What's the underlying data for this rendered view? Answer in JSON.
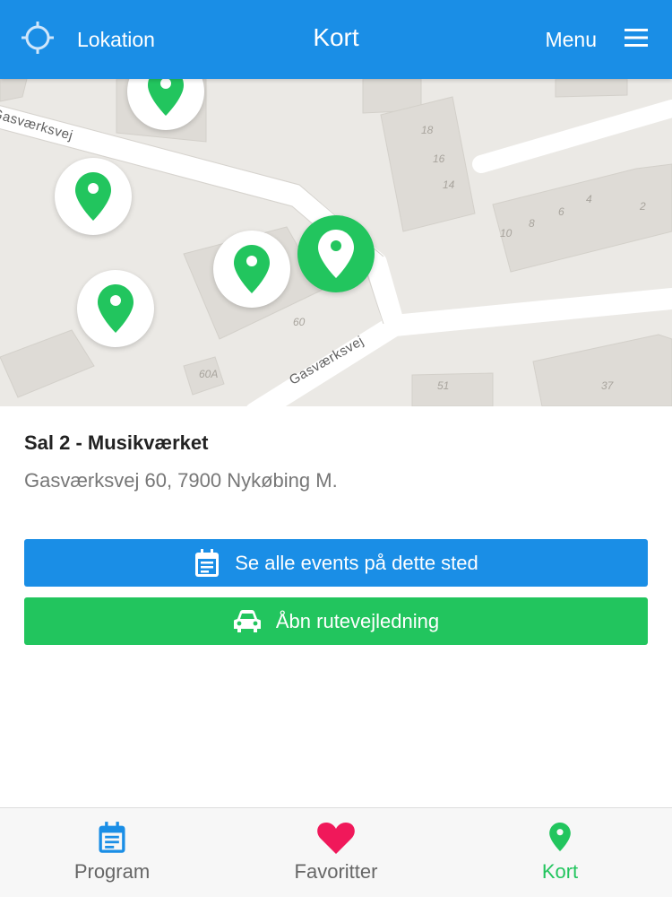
{
  "header": {
    "location_label": "Lokation",
    "title": "Kort",
    "menu_label": "Menu",
    "icons": {
      "location": "crosshair-icon",
      "menu": "hamburger-menu-icon"
    }
  },
  "map": {
    "streets": [
      "Gasværksvej",
      "Gasværksvej"
    ],
    "house_numbers": [
      "18",
      "16",
      "14",
      "10",
      "8",
      "6",
      "4",
      "2",
      "60",
      "60A",
      "51",
      "37"
    ],
    "pin_color": "#22c55e"
  },
  "venue": {
    "name": "Sal 2 - Musikværket",
    "address": "Gasværksvej 60, 7900 Nykøbing M."
  },
  "actions": {
    "events_label": "Se alle events på dette sted",
    "route_label": "Åbn rutevejledning",
    "icons": {
      "events": "calendar-icon",
      "route": "car-icon"
    }
  },
  "tabbar": {
    "items": [
      {
        "label": "Program",
        "icon": "calendar-icon",
        "active": false
      },
      {
        "label": "Favoritter",
        "icon": "heart-icon",
        "active": false
      },
      {
        "label": "Kort",
        "icon": "map-pin-icon",
        "active": true
      }
    ]
  },
  "colors": {
    "primary_blue": "#1a8ee6",
    "accent_green": "#22c55e",
    "favorite_pink": "#f0185a"
  }
}
